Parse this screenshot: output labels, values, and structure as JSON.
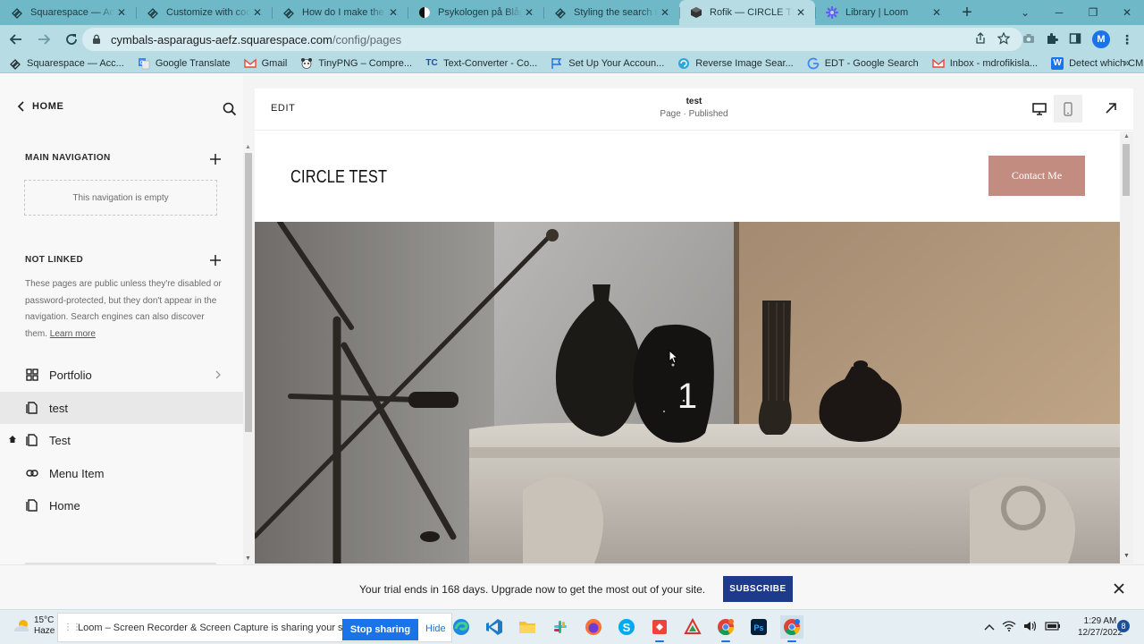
{
  "browser": {
    "tabs": [
      {
        "title": "Squarespace — Acco",
        "icon": "squarespace-icon",
        "active": false
      },
      {
        "title": "Customize with code",
        "icon": "squarespace-icon",
        "active": false
      },
      {
        "title": "How do I make the he",
        "icon": "squarespace-icon",
        "active": false
      },
      {
        "title": "Psykologen på Blåg",
        "icon": "contrast-icon",
        "active": false
      },
      {
        "title": "Styling the search re",
        "icon": "squarespace-icon",
        "active": false
      },
      {
        "title": "Rofik — CIRCLE TEST",
        "icon": "cube-icon",
        "active": true
      },
      {
        "title": "Library | Loom",
        "icon": "loom-icon",
        "active": false
      }
    ],
    "url_host": "cymbals-asparagus-aefz.squarespace.com",
    "url_path": "/config/pages",
    "profile_initial": "M",
    "bookmarks": [
      {
        "label": "Squarespace — Acc...",
        "icon": "squarespace-icon"
      },
      {
        "label": "Google Translate",
        "icon": "translate-icon"
      },
      {
        "label": "Gmail",
        "icon": "gmail-icon"
      },
      {
        "label": "TinyPNG – Compre...",
        "icon": "panda-icon"
      },
      {
        "label": "Text-Converter - Co...",
        "icon": "tc-icon"
      },
      {
        "label": "Set Up Your Accoun...",
        "icon": "flag-icon"
      },
      {
        "label": "Reverse Image Sear...",
        "icon": "reverse-image-icon"
      },
      {
        "label": "EDT - Google Search",
        "icon": "google-icon"
      },
      {
        "label": "Inbox - mdrofikisla...",
        "icon": "gmail-icon"
      },
      {
        "label": "Detect which CMS...",
        "icon": "w-icon"
      }
    ]
  },
  "sidebar": {
    "home_label": "HOME",
    "main_nav_title": "MAIN NAVIGATION",
    "main_nav_empty": "This navigation is empty",
    "not_linked_title": "NOT LINKED",
    "not_linked_note": "These pages are public unless they're disabled or password-protected, but they don't appear in the navigation. Search engines can also discover them.",
    "learn_more": "Learn more",
    "pages": [
      {
        "label": "Portfolio",
        "icon": "grid-icon"
      },
      {
        "label": "test",
        "icon": "page-icon"
      },
      {
        "label": "Test",
        "icon": "page-icon"
      },
      {
        "label": "Menu Item",
        "icon": "link-icon"
      },
      {
        "label": "Home",
        "icon": "page-icon"
      }
    ]
  },
  "editor": {
    "edit_label": "EDIT",
    "page_title": "test",
    "page_status": "Page · Published",
    "site_title": "CIRCLE TEST",
    "contact_label": "Contact Me",
    "hero_number": "1"
  },
  "trial": {
    "message": "Your trial ends in 168 days. Upgrade now to get the most out of your site.",
    "subscribe_label": "SUBSCRIBE"
  },
  "taskbar": {
    "weather_temp": "15°C",
    "weather_desc": "Haze",
    "share_message": "Loom – Screen Recorder & Screen Capture is sharing your screen.",
    "stop_label": "Stop sharing",
    "hide_label": "Hide",
    "time": "1:29 AM",
    "date": "12/27/2022",
    "notifications": "8"
  },
  "colors": {
    "tabstrip": "#6fb8c8",
    "toolbar": "#b7dce4",
    "contact_button": "#c28d80",
    "subscribe_button": "#1e3a8a",
    "stop_sharing": "#1a73e8"
  }
}
